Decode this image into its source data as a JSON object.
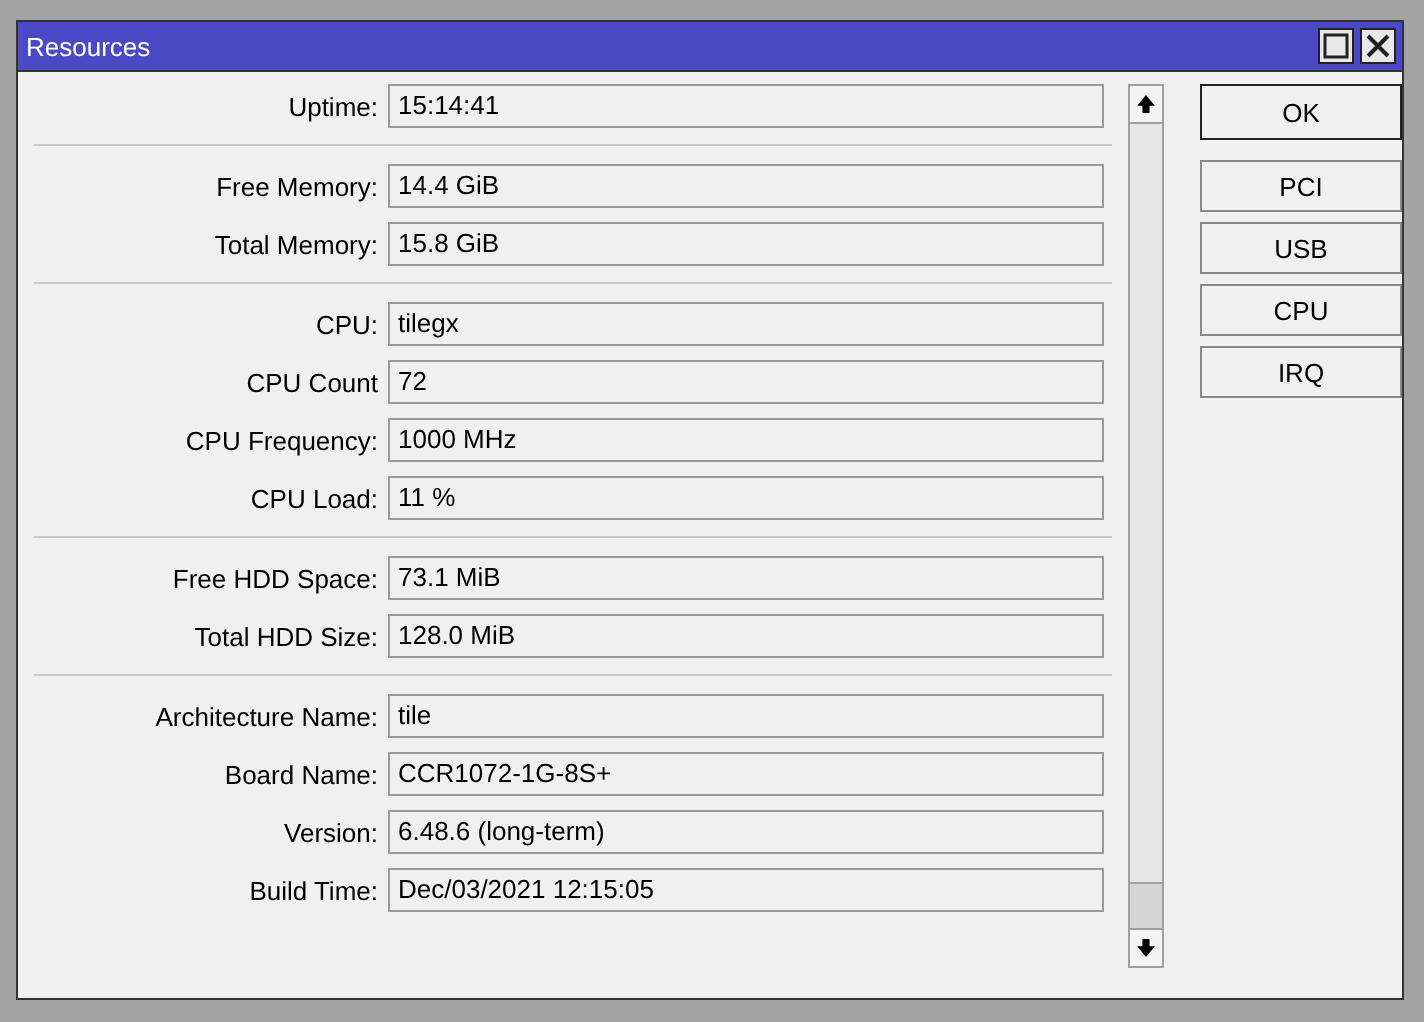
{
  "window": {
    "title": "Resources"
  },
  "groups": [
    {
      "rows": [
        {
          "label": "Uptime:",
          "value": "15:14:41"
        }
      ]
    },
    {
      "rows": [
        {
          "label": "Free Memory:",
          "value": "14.4 GiB"
        },
        {
          "label": "Total Memory:",
          "value": "15.8 GiB"
        }
      ]
    },
    {
      "rows": [
        {
          "label": "CPU:",
          "value": "tilegx"
        },
        {
          "label": "CPU Count",
          "value": "72"
        },
        {
          "label": "CPU Frequency:",
          "value": "1000 MHz"
        },
        {
          "label": "CPU Load:",
          "value": "11 %"
        }
      ]
    },
    {
      "rows": [
        {
          "label": "Free HDD Space:",
          "value": "73.1 MiB"
        },
        {
          "label": "Total HDD Size:",
          "value": "128.0 MiB"
        }
      ]
    },
    {
      "rows": [
        {
          "label": "Architecture Name:",
          "value": "tile"
        },
        {
          "label": "Board Name:",
          "value": "CCR1072-1G-8S+"
        },
        {
          "label": "Version:",
          "value": "6.48.6 (long-term)"
        },
        {
          "label": "Build Time:",
          "value": "Dec/03/2021 12:15:05"
        }
      ]
    }
  ],
  "buttons": [
    {
      "label": "OK",
      "kind": "default"
    },
    {
      "label": "PCI",
      "kind": "normal"
    },
    {
      "label": "USB",
      "kind": "normal"
    },
    {
      "label": "CPU",
      "kind": "normal"
    },
    {
      "label": "IRQ",
      "kind": "normal"
    }
  ]
}
